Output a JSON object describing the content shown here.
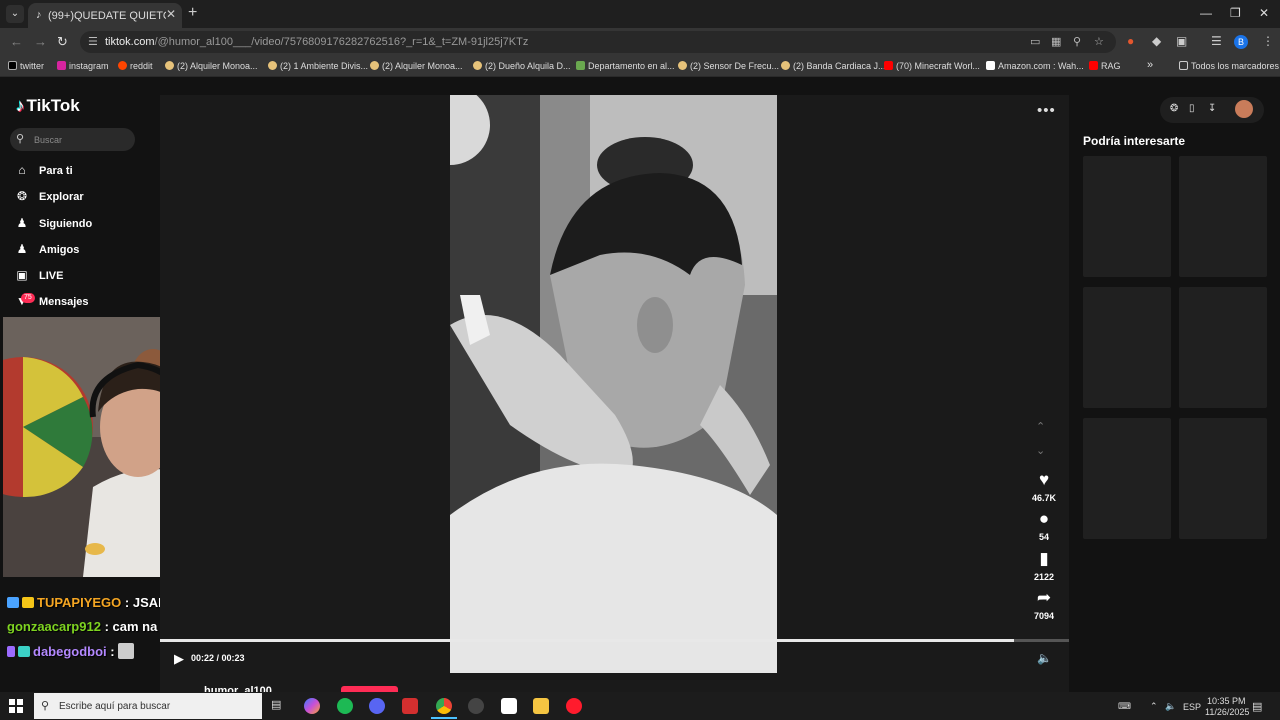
{
  "browser": {
    "tab_title": "(99+)QUEDATE QUIETO🔴🔴 ",
    "url_domain": "tiktok.com",
    "url_path": "/@humor_al100___/video/7576809176282762516?_r=1&_t=ZM-91jl25j7KTz",
    "bookmarks": [
      {
        "label": "twitter",
        "color": "#000000"
      },
      {
        "label": "instagram",
        "color": "#d6249f"
      },
      {
        "label": "reddit",
        "color": "#ff4500"
      },
      {
        "label": "(2) Alquiler Monoa...",
        "color": "#e6c27a"
      },
      {
        "label": "(2) 1 Ambiente Divis...",
        "color": "#e6c27a"
      },
      {
        "label": "(2) Alquiler Monoa...",
        "color": "#e6c27a"
      },
      {
        "label": "(2) Dueño Alquila D...",
        "color": "#e6c27a"
      },
      {
        "label": "Departamento en al...",
        "color": "#6aa84f"
      },
      {
        "label": "(2) Sensor De Frecu...",
        "color": "#e6c27a"
      },
      {
        "label": "(2) Banda Cardiaca J...",
        "color": "#e6c27a"
      },
      {
        "label": "(70) Minecraft Worl...",
        "color": "#ff0000"
      },
      {
        "label": "Amazon.com : Wah...",
        "color": "#ffffff"
      },
      {
        "label": "RAG",
        "color": "#ff0000"
      }
    ],
    "bookmarks_overflow": "»",
    "all_bookmarks": "Todos los marcadores"
  },
  "sidebar": {
    "logo_text": "TikTok",
    "search_placeholder": "Buscar",
    "nav": [
      {
        "label": "Para ti",
        "icon": "home-icon"
      },
      {
        "label": "Explorar",
        "icon": "compass-icon"
      },
      {
        "label": "Siguiendo",
        "icon": "following-icon"
      },
      {
        "label": "Amigos",
        "icon": "friends-icon"
      },
      {
        "label": "LIVE",
        "icon": "live-icon"
      },
      {
        "label": "Mensajes",
        "icon": "messages-icon"
      }
    ],
    "messages_badge": "75"
  },
  "chat": [
    {
      "user": "TUPAPIYEGO",
      "message": ": JSADJHLKASJKLHJAS",
      "color": "#f5a623"
    },
    {
      "user": "gonzaacarp912",
      "message": ": cam na ir?",
      "color": "#7ed321"
    },
    {
      "user": "dabegodboi",
      "message": ": ",
      "color": "#b388ff"
    }
  ],
  "video": {
    "likes": "46.7K",
    "comments": "54",
    "saves": "2122",
    "shares": "7094",
    "time": "00:22 / 00:23",
    "progress": 0.94,
    "author": "humor_al100"
  },
  "right_panel": {
    "title": "Podría interesarte"
  },
  "taskbar": {
    "search_placeholder": "Escribe aquí para buscar",
    "lang": "ESP",
    "time": "10:35 PM",
    "date": "11/26/2025"
  },
  "colors": {
    "tiktok_red": "#fe2c55",
    "tiktok_cyan": "#25f4ee",
    "page_bg": "#121212"
  }
}
